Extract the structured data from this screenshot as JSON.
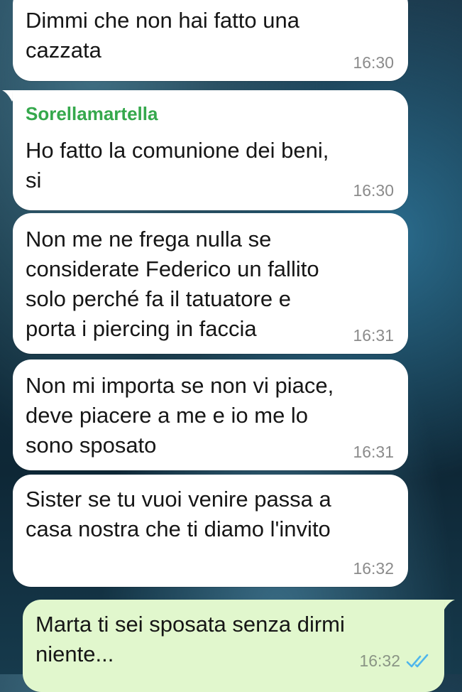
{
  "messages": [
    {
      "direction": "incoming",
      "text": "Dimmi che non hai fatto una\ncazzata",
      "time": "16:30"
    },
    {
      "direction": "incoming",
      "sender": "Sorellamartella",
      "text": "Ho fatto la comunione dei beni,\nsi",
      "time": "16:30"
    },
    {
      "direction": "incoming",
      "text": "Non me ne frega nulla se\nconsiderate Federico un fallito\nsolo perché fa il tatuatore e\nporta i piercing in faccia",
      "time": "16:31"
    },
    {
      "direction": "incoming",
      "text": "Non mi importa se non vi piace,\ndeve piacere a me e io me lo\nsono sposato",
      "time": "16:31"
    },
    {
      "direction": "incoming",
      "text": "Sister se tu vuoi venire passa a\ncasa nostra che ti diamo l'invito",
      "time": "16:32"
    },
    {
      "direction": "outgoing",
      "text": "Marta ti sei sposata senza dirmi\nniente...",
      "time": "16:32",
      "status": "read"
    }
  ],
  "colors": {
    "incoming_bubble": "#ffffff",
    "outgoing_bubble": "#e1f7cd",
    "sender_name": "#35a84c",
    "read_ticks": "#4fb6ec",
    "timestamp": "#8b8b8b"
  },
  "icons": {
    "read_status": "double-check-icon"
  }
}
